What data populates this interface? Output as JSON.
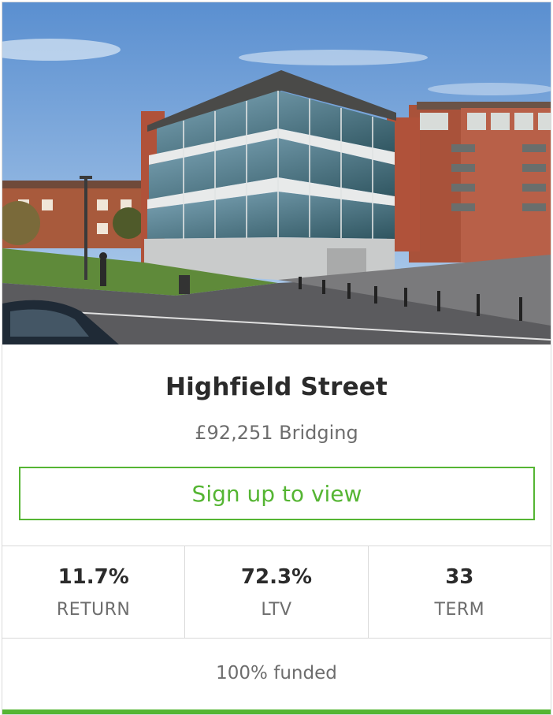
{
  "listing": {
    "title": "Highfield Street",
    "subtitle": "£92,251 Bridging",
    "cta_label": "Sign up to view",
    "funded_text": "100% funded",
    "funded_fraction": 1.0,
    "accent_color": "#55b533"
  },
  "stats": [
    {
      "value": "11.7%",
      "label": "RETURN"
    },
    {
      "value": "72.3%",
      "label": "LTV"
    },
    {
      "value": "33",
      "label": "TERM"
    }
  ]
}
